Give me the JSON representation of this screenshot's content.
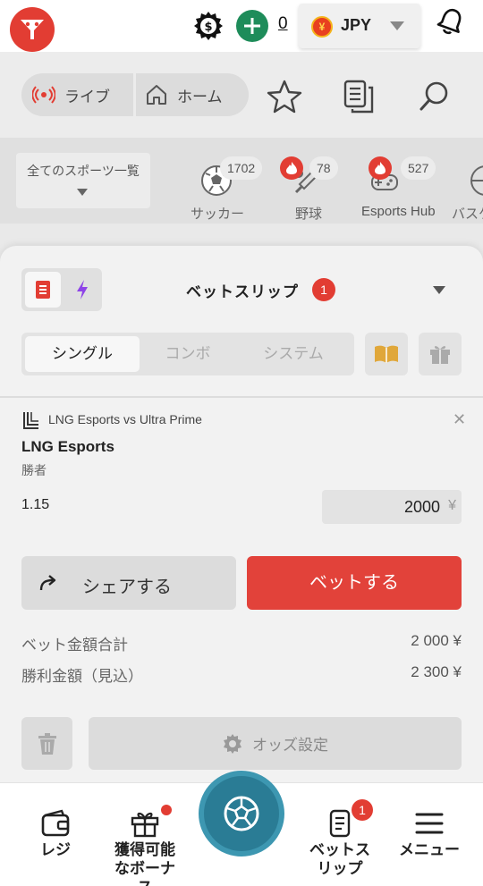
{
  "header": {
    "balance": "0",
    "currency": "JPY",
    "currency_symbol": "¥"
  },
  "nav": {
    "live_label": "ライブ",
    "home_label": "ホーム"
  },
  "sports": {
    "all_label": "全てのスポーツ一覧",
    "items": [
      {
        "name": "サッカー",
        "count": "1702",
        "hot": false
      },
      {
        "name": "野球",
        "count": "78",
        "hot": true
      },
      {
        "name": "Esports Hub",
        "count": "527",
        "hot": true
      },
      {
        "name": "バスケ",
        "count": "",
        "hot": false
      }
    ]
  },
  "betslip": {
    "title": "ベットスリップ",
    "badge": "1",
    "tabs": [
      "シングル",
      "コンボ",
      "システム"
    ],
    "active_tab": 0,
    "bet": {
      "match": "LNG Esports vs Ultra Prime",
      "selection": "LNG Esports",
      "market": "勝者",
      "odds": "1.15",
      "stake": "2000",
      "stake_currency": "¥"
    },
    "share_label": "シェアする",
    "place_label": "ベットする",
    "summary": {
      "total_label": "ベット金額合計",
      "total_value": "2 000 ¥",
      "win_label": "勝利金額（見込）",
      "win_value": "2 300 ¥"
    },
    "odds_settings_label": "オッズ設定"
  },
  "bottom_nav": {
    "cashier": "レジ",
    "bonus": "獲得可能なボーナス",
    "betslip": "ベットスリップ",
    "betslip_badge": "1",
    "menu": "メニュー"
  },
  "colors": {
    "brand_red": "#e23d33",
    "bet_button": "#e2423a",
    "green": "#1e8c5a",
    "center_button": "#2a7c95",
    "bolt_purple": "#8e44e8"
  }
}
